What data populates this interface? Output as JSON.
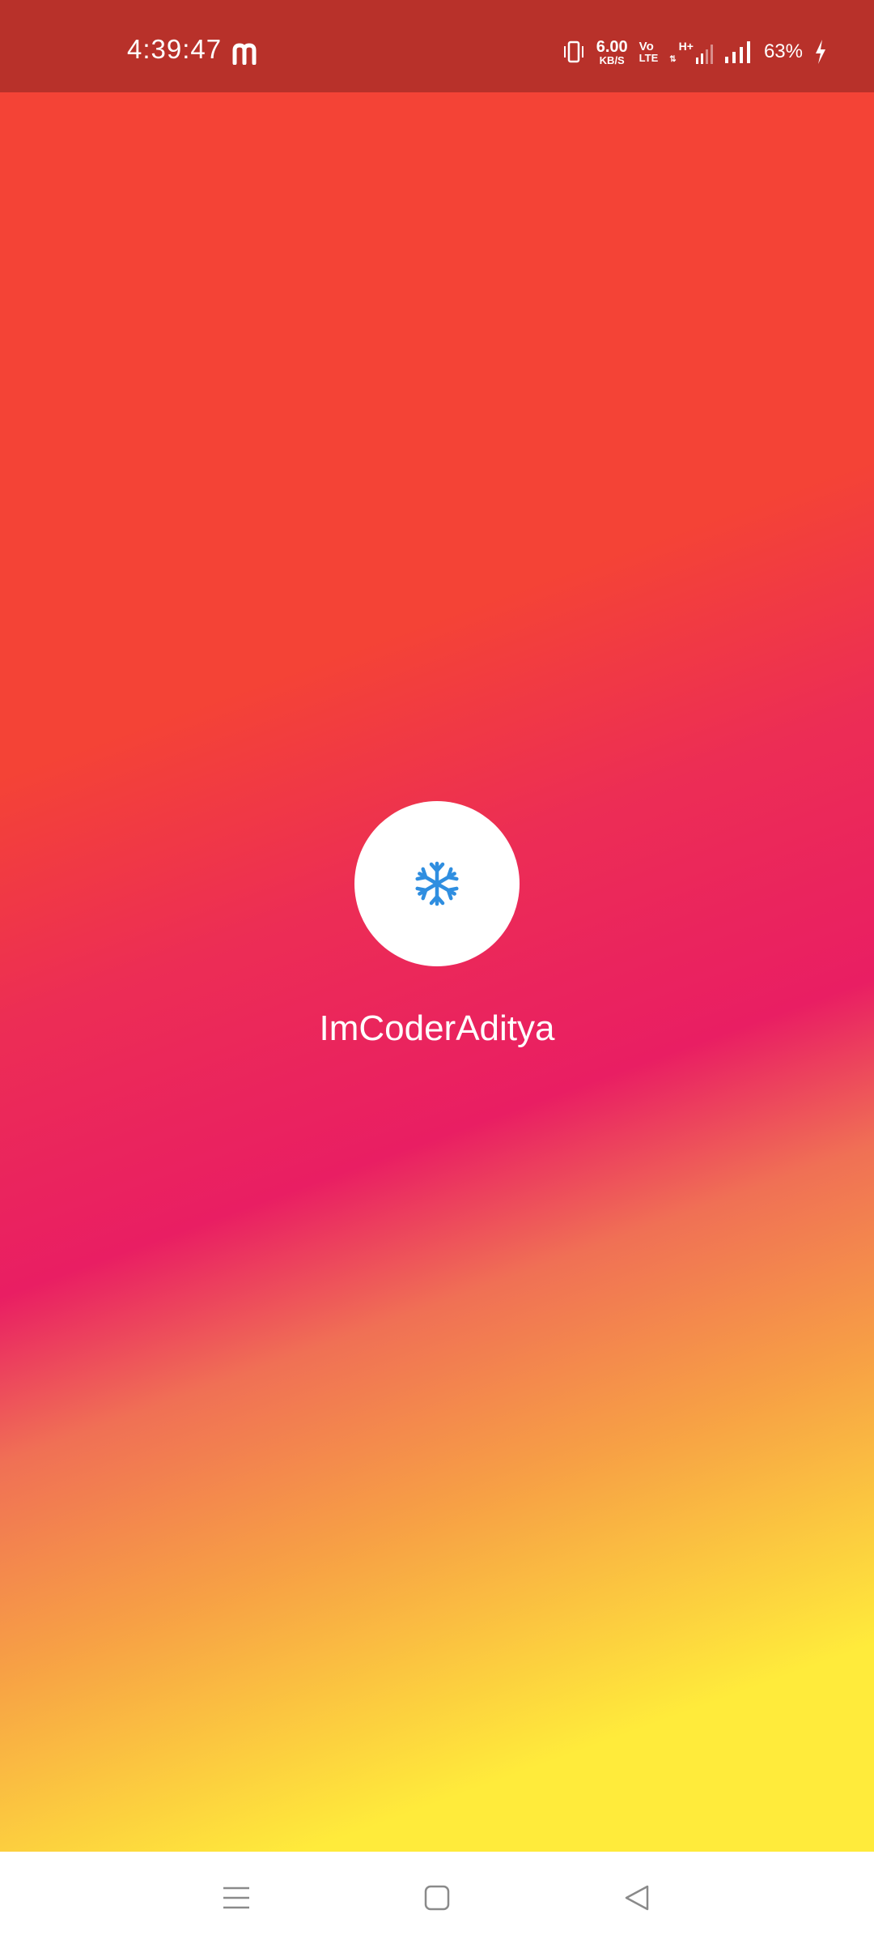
{
  "status_bar": {
    "time": "4:39:47",
    "app_icon": "m-logo-icon",
    "speed_value": "6.00",
    "speed_unit": "KB/S",
    "volte_top": "Vo",
    "volte_bottom": "LTE",
    "network": "H+",
    "battery": "63%",
    "background_color": "#b8312a"
  },
  "splash": {
    "app_name": "ImCoderAditya",
    "logo_icon": "snowflake-icon",
    "logo_color": "#2f8ee0",
    "gradient_colors": [
      "#f44336",
      "#e91e63",
      "#ffeb3b"
    ]
  },
  "nav_bar": {
    "items": [
      "menu-icon",
      "home-icon",
      "back-icon"
    ]
  }
}
